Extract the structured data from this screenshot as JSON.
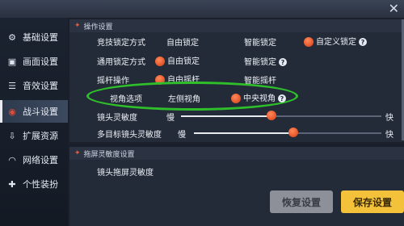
{
  "sidebar": {
    "items": [
      {
        "label": "基础设置",
        "icon": "gear-icon",
        "glyph": "⚙"
      },
      {
        "label": "画面设置",
        "icon": "image-icon",
        "glyph": "▣"
      },
      {
        "label": "音效设置",
        "icon": "sliders-icon",
        "glyph": "☰"
      },
      {
        "label": "战斗设置",
        "icon": "combat-icon",
        "glyph": "◉"
      },
      {
        "label": "扩展资源",
        "icon": "download-icon",
        "glyph": "⇩"
      },
      {
        "label": "网络设置",
        "icon": "wifi-icon",
        "glyph": "◠"
      },
      {
        "label": "个性装扮",
        "icon": "gamepad-icon",
        "glyph": "✚"
      }
    ],
    "active_index": 3
  },
  "section1": {
    "title": "操作设置",
    "rows": {
      "lock": {
        "label": "竞技锁定方式",
        "opt1": "自由锁定",
        "opt2": "智能锁定",
        "opt3": "自定义锁定"
      },
      "general_lock": {
        "label": "通用锁定方式",
        "opt1": "自由锁定",
        "opt2": "智能锁定"
      },
      "joystick": {
        "label": "摇杆操作",
        "opt1": "自由摇杆",
        "opt2": "智能摇杆"
      },
      "view": {
        "label": "视角选项",
        "opt1": "左侧视角",
        "opt2": "中央视角"
      },
      "sensitivity": {
        "label": "镜头灵敏度",
        "min": "慢",
        "max": "快",
        "value": 0.45
      },
      "multi_sensitivity": {
        "label": "多目标镜头灵敏度",
        "min": "慢",
        "max": "快",
        "value": 0.53
      }
    }
  },
  "section2": {
    "title": "拖屏灵敏度设置",
    "rows": {
      "drag": {
        "label": "镜头拖屏灵敏度"
      }
    }
  },
  "buttons": {
    "reset": "恢复设置",
    "save": "保存设置"
  },
  "colors": {
    "accent": "#e85a2e",
    "highlight": "#2fbf2a",
    "save": "#f3c23a"
  }
}
